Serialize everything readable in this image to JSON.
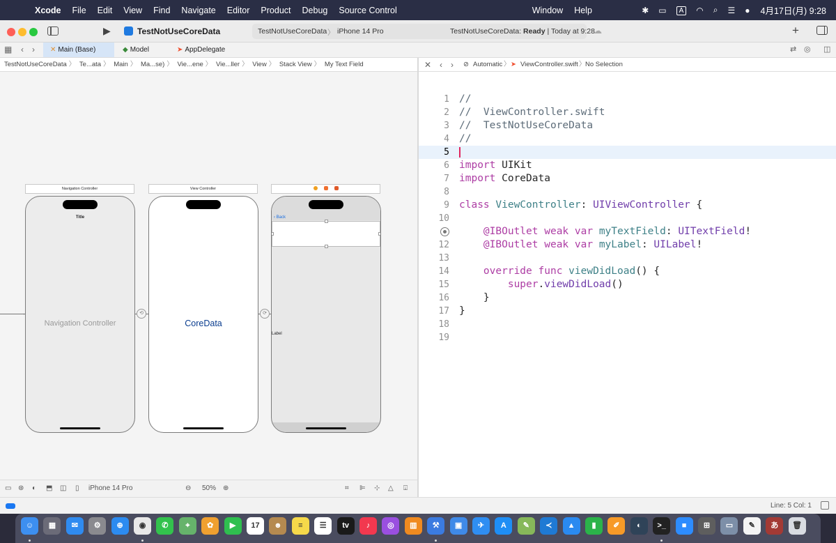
{
  "menubar": {
    "app_name": "Xcode",
    "menus": [
      "File",
      "Edit",
      "View",
      "Find",
      "Navigate",
      "Editor",
      "Product",
      "Debug",
      "Source Control",
      "Window",
      "Help"
    ],
    "input_mode": "A",
    "clock": "4月17日(月) 9:28"
  },
  "toolbar": {
    "project_name": "TestNotUseCoreData",
    "scheme": "TestNotUseCoreData",
    "device": "iPhone 14 Pro",
    "status_project": "TestNotUseCoreData:",
    "status_state": "Ready",
    "status_time": "| Today at 9:28"
  },
  "tabs": [
    {
      "label": "Main (Base)",
      "icon": "storyboard-icon",
      "active": true
    },
    {
      "label": "Model",
      "icon": "datamodel-icon",
      "active": false
    },
    {
      "label": "AppDelegate",
      "icon": "swift-icon",
      "active": false
    }
  ],
  "jumpbar_left": [
    "TestNotUseCoreData",
    "Te...ata",
    "Main",
    "Ma...se)",
    "Vie...ene",
    "Vie...ller",
    "View",
    "Stack View",
    "My Text Field"
  ],
  "jumpbar_right": {
    "mode": "Automatic",
    "file": "ViewController.swift",
    "selection": "No Selection"
  },
  "canvas": {
    "scenes": [
      {
        "title": "Navigation Controller",
        "nav_title": "Title",
        "center_label": "Navigation Controller"
      },
      {
        "title": "View Controller",
        "center_label": "CoreData"
      },
      {
        "title": "",
        "back_label": "Back",
        "label_text": "Label"
      }
    ],
    "device": "iPhone 14 Pro",
    "zoom": "50%"
  },
  "editor": {
    "current_line": 5,
    "lines": [
      {
        "n": "1",
        "tokens": [
          {
            "t": "//",
            "c": "cm"
          }
        ]
      },
      {
        "n": "2",
        "tokens": [
          {
            "t": "//  ViewController.swift",
            "c": "cm"
          }
        ]
      },
      {
        "n": "3",
        "tokens": [
          {
            "t": "//  TestNotUseCoreData",
            "c": "cm"
          }
        ]
      },
      {
        "n": "4",
        "tokens": [
          {
            "t": "//",
            "c": "cm"
          }
        ]
      },
      {
        "n": "5",
        "tokens": []
      },
      {
        "n": "6",
        "tokens": [
          {
            "t": "import",
            "c": "kw"
          },
          {
            "t": " UIKit",
            "c": ""
          }
        ]
      },
      {
        "n": "7",
        "tokens": [
          {
            "t": "import",
            "c": "kw"
          },
          {
            "t": " CoreData",
            "c": ""
          }
        ]
      },
      {
        "n": "8",
        "tokens": []
      },
      {
        "n": "9",
        "tokens": [
          {
            "t": "class",
            "c": "kw"
          },
          {
            "t": " ",
            "c": ""
          },
          {
            "t": "ViewController",
            "c": "fn"
          },
          {
            "t": ": ",
            "c": ""
          },
          {
            "t": "UIViewController",
            "c": "ty"
          },
          {
            "t": " {",
            "c": ""
          }
        ]
      },
      {
        "n": "10",
        "tokens": []
      },
      {
        "n": "11",
        "breakpoint": true,
        "tokens": [
          {
            "t": "    ",
            "c": ""
          },
          {
            "t": "@IBOutlet",
            "c": "kw"
          },
          {
            "t": " ",
            "c": ""
          },
          {
            "t": "weak",
            "c": "kw"
          },
          {
            "t": " ",
            "c": ""
          },
          {
            "t": "var",
            "c": "kw"
          },
          {
            "t": " ",
            "c": ""
          },
          {
            "t": "myTextField",
            "c": "fn"
          },
          {
            "t": ": ",
            "c": ""
          },
          {
            "t": "UITextField",
            "c": "ty"
          },
          {
            "t": "!",
            "c": ""
          }
        ]
      },
      {
        "n": "12",
        "tokens": [
          {
            "t": "    ",
            "c": ""
          },
          {
            "t": "@IBOutlet",
            "c": "kw"
          },
          {
            "t": " ",
            "c": ""
          },
          {
            "t": "weak",
            "c": "kw"
          },
          {
            "t": " ",
            "c": ""
          },
          {
            "t": "var",
            "c": "kw"
          },
          {
            "t": " ",
            "c": ""
          },
          {
            "t": "myLabel",
            "c": "fn"
          },
          {
            "t": ": ",
            "c": ""
          },
          {
            "t": "UILabel",
            "c": "ty"
          },
          {
            "t": "!",
            "c": ""
          }
        ]
      },
      {
        "n": "13",
        "tokens": []
      },
      {
        "n": "14",
        "tokens": [
          {
            "t": "    ",
            "c": ""
          },
          {
            "t": "override",
            "c": "kw"
          },
          {
            "t": " ",
            "c": ""
          },
          {
            "t": "func",
            "c": "kw"
          },
          {
            "t": " ",
            "c": ""
          },
          {
            "t": "viewDidLoad",
            "c": "fn"
          },
          {
            "t": "() {",
            "c": ""
          }
        ]
      },
      {
        "n": "15",
        "tokens": [
          {
            "t": "        ",
            "c": ""
          },
          {
            "t": "super",
            "c": "kw"
          },
          {
            "t": ".",
            "c": ""
          },
          {
            "t": "viewDidLoad",
            "c": "ty"
          },
          {
            "t": "()",
            "c": ""
          }
        ]
      },
      {
        "n": "16",
        "tokens": [
          {
            "t": "    }",
            "c": ""
          }
        ]
      },
      {
        "n": "17",
        "tokens": [
          {
            "t": "}",
            "c": ""
          }
        ]
      },
      {
        "n": "18",
        "tokens": []
      },
      {
        "n": "19",
        "tokens": []
      }
    ]
  },
  "statusbar": {
    "position": "Line: 5  Col: 1"
  },
  "dock": {
    "apps": [
      {
        "name": "finder-icon",
        "color": "#3d8ff0",
        "glyph": "☺"
      },
      {
        "name": "launchpad-icon",
        "color": "#6b6b78",
        "glyph": "▦"
      },
      {
        "name": "mail-icon",
        "color": "#2f8bf0",
        "glyph": "✉"
      },
      {
        "name": "system-settings-icon",
        "color": "#8a8a8f",
        "glyph": "⚙"
      },
      {
        "name": "safari-icon",
        "color": "#2c8bf0",
        "glyph": "⊕"
      },
      {
        "name": "chrome-icon",
        "color": "#e8e8e8",
        "glyph": "◉"
      },
      {
        "name": "messages-icon",
        "color": "#33c24d",
        "glyph": "✆"
      },
      {
        "name": "maps-icon",
        "color": "#66b36b",
        "glyph": "⌖"
      },
      {
        "name": "photos-icon",
        "color": "#f0a030",
        "glyph": "✿"
      },
      {
        "name": "facetime-icon",
        "color": "#2fbf4f",
        "glyph": "▶"
      },
      {
        "name": "calendar-icon",
        "color": "#ffffff",
        "glyph": "17"
      },
      {
        "name": "contacts-icon",
        "color": "#b58a50",
        "glyph": "☻"
      },
      {
        "name": "notes-icon",
        "color": "#f6d94a",
        "glyph": "≡"
      },
      {
        "name": "reminders-icon",
        "color": "#ffffff",
        "glyph": "☰"
      },
      {
        "name": "tv-icon",
        "color": "#1a1a1a",
        "glyph": "tv"
      },
      {
        "name": "music-icon",
        "color": "#f2384f",
        "glyph": "♪"
      },
      {
        "name": "podcasts-icon",
        "color": "#9a4fe0",
        "glyph": "◎"
      },
      {
        "name": "books-icon",
        "color": "#f08a20",
        "glyph": "▥"
      },
      {
        "name": "xcode-icon",
        "color": "#3b7be0",
        "glyph": "⚒"
      },
      {
        "name": "simulator-icon",
        "color": "#3f8ae8",
        "glyph": "▣"
      },
      {
        "name": "testflight-icon",
        "color": "#2f8ef2",
        "glyph": "✈"
      },
      {
        "name": "app-store-icon",
        "color": "#1e8ef5",
        "glyph": "A"
      },
      {
        "name": "script-editor-icon",
        "color": "#87b85a",
        "glyph": "✎"
      },
      {
        "name": "vscode-icon",
        "color": "#1f7ad4",
        "glyph": "≺"
      },
      {
        "name": "keynote-icon",
        "color": "#2a8af0",
        "glyph": "▲"
      },
      {
        "name": "numbers-icon",
        "color": "#2bb34a",
        "glyph": "▮"
      },
      {
        "name": "pages-icon",
        "color": "#f79a28",
        "glyph": "✐"
      },
      {
        "name": "github-desktop-icon",
        "color": "#2f4358",
        "glyph": "◐"
      },
      {
        "name": "terminal-icon",
        "color": "#222222",
        "glyph": ">_"
      },
      {
        "name": "zoom-icon",
        "color": "#2d8cff",
        "glyph": "■"
      },
      {
        "name": "calculator-icon",
        "color": "#5e5e5e",
        "glyph": "⊞"
      },
      {
        "name": "preview-icon",
        "color": "#7d8fa8",
        "glyph": "▭"
      },
      {
        "name": "textedit-icon",
        "color": "#f4f4f4",
        "glyph": "✎"
      },
      {
        "name": "dictionary-icon",
        "color": "#a33a35",
        "glyph": "あ"
      },
      {
        "name": "trash-icon",
        "color": "#d9dce2",
        "glyph": "🗑"
      }
    ]
  },
  "colors": {
    "keyword": "#ad3da4",
    "type": "#703daa",
    "identifier": "#3e8087",
    "comment": "#5d6c79",
    "accent": "#1a78f2"
  }
}
